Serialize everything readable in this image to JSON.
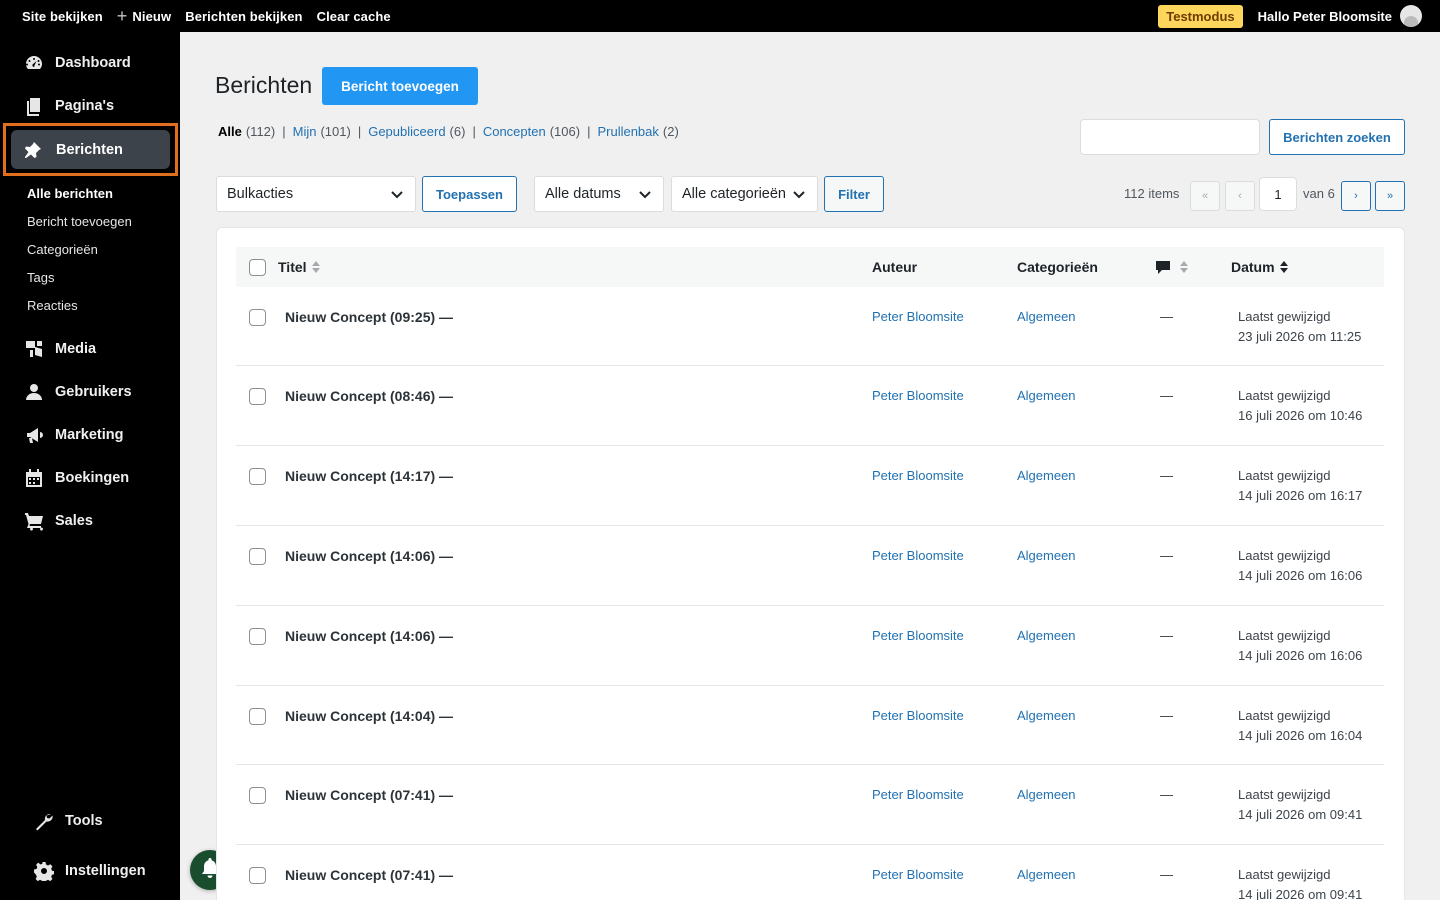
{
  "adminbar": {
    "site_view": "Site bekijken",
    "new": "Nieuw",
    "view_posts": "Berichten bekijken",
    "clear_cache": "Clear cache",
    "testmode_badge": "Testmodus",
    "greeting": "Hallo Peter Bloomsite"
  },
  "sidebar": {
    "items": [
      {
        "label": "Dashboard",
        "icon": "dashboard-icon"
      },
      {
        "label": "Pagina's",
        "icon": "pages-icon"
      },
      {
        "label": "Berichten",
        "icon": "pin-icon"
      },
      {
        "label": "Media",
        "icon": "media-icon"
      },
      {
        "label": "Gebruikers",
        "icon": "users-icon"
      },
      {
        "label": "Marketing",
        "icon": "megaphone-icon"
      },
      {
        "label": "Boekingen",
        "icon": "calendar-icon"
      },
      {
        "label": "Sales",
        "icon": "cart-icon"
      },
      {
        "label": "Tools",
        "icon": "wrench-icon"
      },
      {
        "label": "Instellingen",
        "icon": "gear-icon"
      }
    ],
    "submenu": [
      "Alle berichten",
      "Bericht toevoegen",
      "Categorieën",
      "Tags",
      "Reacties"
    ],
    "highlight_color": "#e0701e"
  },
  "page": {
    "title": "Berichten",
    "add_button": "Bericht toevoegen",
    "views": [
      {
        "label": "Alle",
        "count": "(112)"
      },
      {
        "label": "Mijn",
        "count": "(101)"
      },
      {
        "label": "Gepubliceerd",
        "count": "(6)"
      },
      {
        "label": "Concepten",
        "count": "(106)"
      },
      {
        "label": "Prullenbak",
        "count": "(2)"
      }
    ],
    "search_button": "Berichten zoeken",
    "bulk_actions": "Bulkacties",
    "apply_button": "Toepassen",
    "dates_filter": "Alle datums",
    "categories_filter": "Alle categorieën",
    "filter_button": "Filter",
    "pagination": {
      "items": "112 items",
      "first": "«",
      "prev": "‹",
      "current_page": "1",
      "of": "van 6",
      "next": "›",
      "last": "»"
    }
  },
  "table": {
    "columns": {
      "title": "Titel",
      "author": "Auteur",
      "categories": "Categorieën",
      "comments_icon": "comment-icon",
      "date": "Datum"
    },
    "rows": [
      {
        "title": "Nieuw Concept (09:25) —",
        "author": "Peter Bloomsite",
        "category": "Algemeen",
        "comments": "—",
        "date_status": "Laatst gewijzigd",
        "date": "23 juli 2026 om 11:25"
      },
      {
        "title": "Nieuw Concept (08:46) —",
        "author": "Peter Bloomsite",
        "category": "Algemeen",
        "comments": "—",
        "date_status": "Laatst gewijzigd",
        "date": "16 juli 2026 om 10:46"
      },
      {
        "title": "Nieuw Concept (14:17) —",
        "author": "Peter Bloomsite",
        "category": "Algemeen",
        "comments": "—",
        "date_status": "Laatst gewijzigd",
        "date": "14 juli 2026 om 16:17"
      },
      {
        "title": "Nieuw Concept (14:06) —",
        "author": "Peter Bloomsite",
        "category": "Algemeen",
        "comments": "—",
        "date_status": "Laatst gewijzigd",
        "date": "14 juli 2026 om 16:06"
      },
      {
        "title": "Nieuw Concept (14:06) —",
        "author": "Peter Bloomsite",
        "category": "Algemeen",
        "comments": "—",
        "date_status": "Laatst gewijzigd",
        "date": "14 juli 2026 om 16:06"
      },
      {
        "title": "Nieuw Concept (14:04) —",
        "author": "Peter Bloomsite",
        "category": "Algemeen",
        "comments": "—",
        "date_status": "Laatst gewijzigd",
        "date": "14 juli 2026 om 16:04"
      },
      {
        "title": "Nieuw Concept (07:41) —",
        "author": "Peter Bloomsite",
        "category": "Algemeen",
        "comments": "—",
        "date_status": "Laatst gewijzigd",
        "date": "14 juli 2026 om 09:41"
      },
      {
        "title": "Nieuw Concept (07:41) —",
        "author": "Peter Bloomsite",
        "category": "Algemeen",
        "comments": "—",
        "date_status": "Laatst gewijzigd",
        "date": "14 juli 2026 om 09:41"
      }
    ]
  }
}
